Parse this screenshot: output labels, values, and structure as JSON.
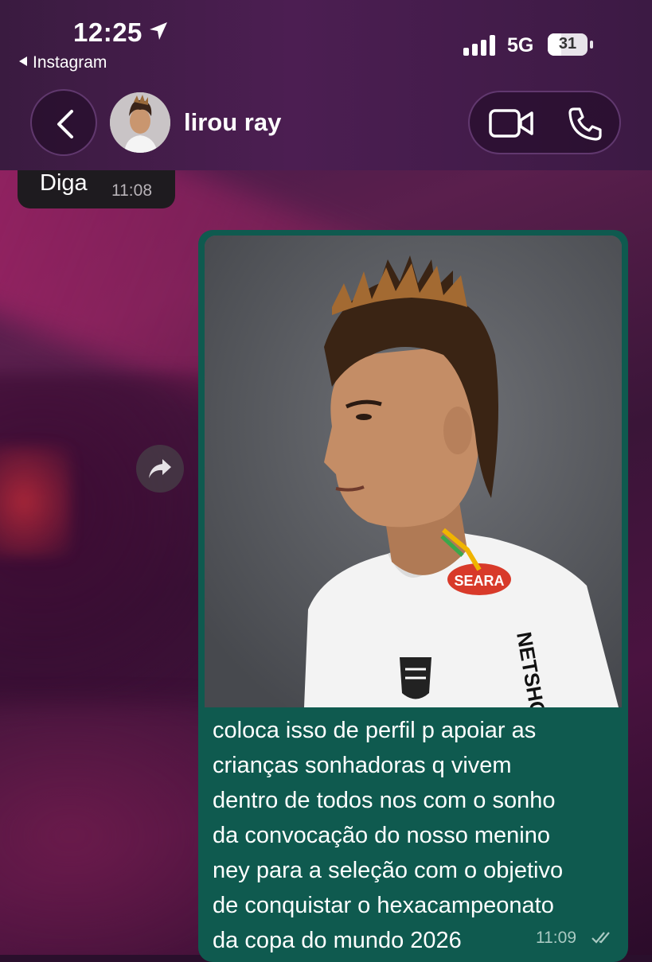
{
  "status_bar": {
    "time": "12:25",
    "back_app": "Instagram",
    "network": "5G",
    "battery": "31"
  },
  "header": {
    "contact_name": "lirou ray",
    "back_icon": "chevron-left-icon",
    "avatar_icon": "avatar",
    "video_icon": "video-camera-icon",
    "phone_icon": "phone-icon"
  },
  "messages": {
    "incoming": {
      "text": "Diga",
      "time": "11:08"
    },
    "outgoing": {
      "caption": "coloca isso de perfil p apoiar as\ncrianças sonhadoras q vivem\ndentro de todos nos com o sonho\nda convocação do nosso menino\nney para a seleção com o objetivo\nde conquistar o hexacampeonato\nda copa do mundo 2026",
      "time": "11:09",
      "jersey_brands": [
        "SEARA",
        "NETSHOES"
      ]
    }
  },
  "colors": {
    "outgoing_bubble": "#0f5a4f",
    "incoming_bubble": "#1e1b1f",
    "header": "#4c1e52"
  }
}
